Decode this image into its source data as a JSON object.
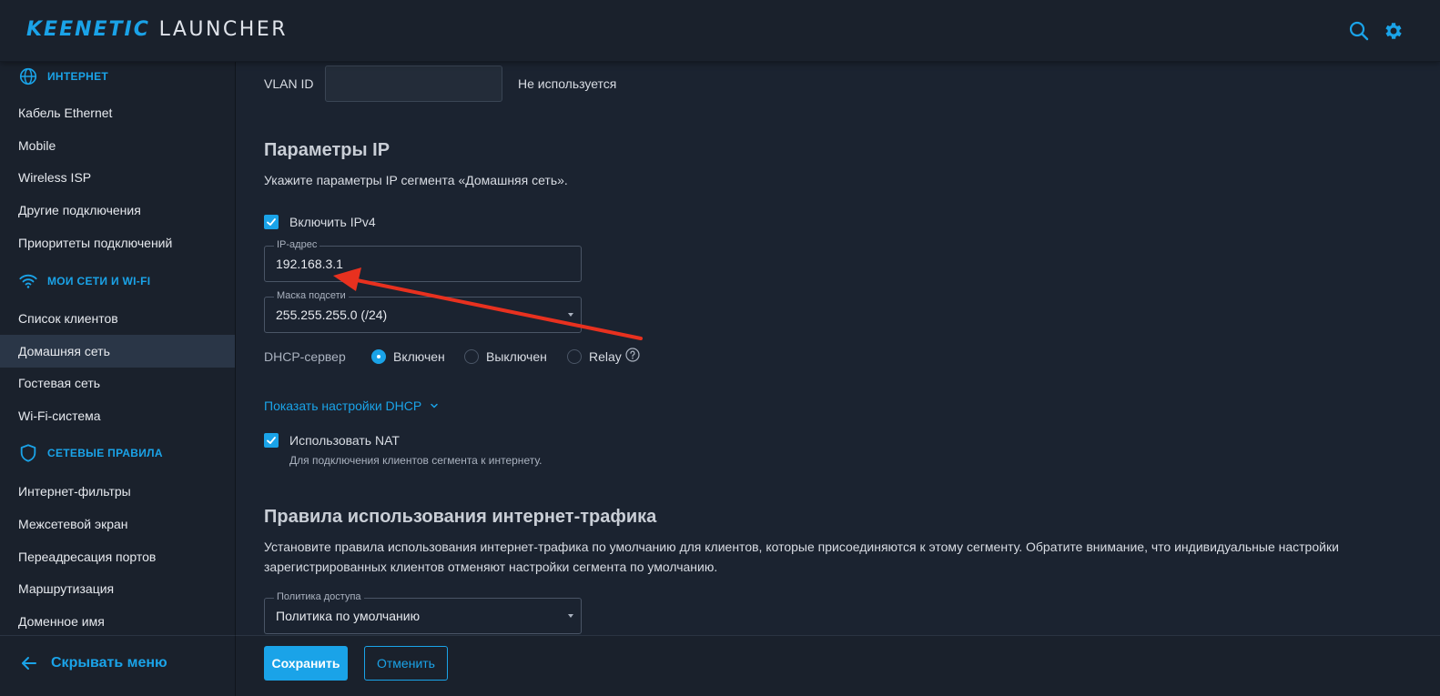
{
  "header": {
    "brand": "KEENETIC",
    "product": "LAUNCHER",
    "search_icon": "search-icon",
    "settings_icon": "gear-icon"
  },
  "sidebar": {
    "sections": [
      {
        "title": "ИНТЕРНЕТ",
        "icon": "globe-icon",
        "items": [
          "Кабель Ethernet",
          "Mobile",
          "Wireless ISP",
          "Другие подключения",
          "Приоритеты подключений"
        ]
      },
      {
        "title": "МОИ СЕТИ И WI-FI",
        "icon": "wifi-icon",
        "items": [
          "Список клиентов",
          "Домашняя сеть",
          "Гостевая сеть",
          "Wi-Fi-система"
        ]
      },
      {
        "title": "СЕТЕВЫЕ ПРАВИЛА",
        "icon": "shield-icon",
        "items": [
          "Интернет-фильтры",
          "Межсетевой экран",
          "Переадресация портов",
          "Маршрутизация",
          "Доменное имя"
        ]
      }
    ],
    "active_item": "Домашняя сеть",
    "hide_menu": "Скрывать меню"
  },
  "main": {
    "vlan": {
      "label": "VLAN ID",
      "value": "",
      "status": "Не используется"
    },
    "ip_params": {
      "title": "Параметры IP",
      "description": "Укажите параметры IP сегмента «Домашняя сеть».",
      "ipv4_label": "Включить IPv4",
      "ipv4_checked": true,
      "ip_field_label": "IP-адрес",
      "ip_value": "192.168.3.1",
      "mask_label": "Маска подсети",
      "mask_value": "255.255.255.0 (/24)",
      "dhcp_label": "DHCP-сервер",
      "dhcp_options": [
        "Включен",
        "Выключен",
        "Relay"
      ],
      "dhcp_selected": "Включен",
      "show_dhcp": "Показать настройки DHCP",
      "nat_label": "Использовать NAT",
      "nat_checked": true,
      "nat_hint": "Для подключения клиентов сегмента к интернету."
    },
    "traffic_rules": {
      "title": "Правила использования интернет-трафика",
      "description_line1": "Установите правила использования интернет-трафика по умолчанию для клиентов, которые присоединяются к этому сегменту. Обратите внимание, что индивидуальные настройки",
      "description_line2": "зарегистрированных клиентов отменяют настройки сегмента по умолчанию.",
      "policy_label": "Политика доступа",
      "policy_value": "Политика по умолчанию"
    }
  },
  "footer": {
    "save": "Сохранить",
    "cancel": "Отменить"
  },
  "colors": {
    "accent": "#1aa3e8",
    "annotation_arrow": "#e8311f"
  }
}
